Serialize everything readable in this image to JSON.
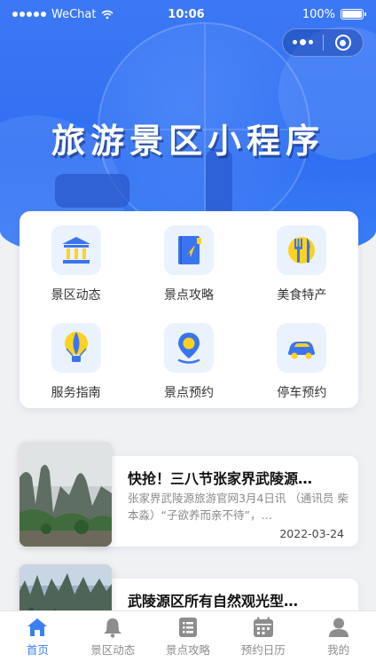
{
  "status_bar": {
    "carrier": "WeChat",
    "time": "10:06",
    "battery": "100%"
  },
  "hero": {
    "title": "旅游景区小程序"
  },
  "menu": {
    "items": [
      {
        "label": "景区动态",
        "icon": "museum-icon"
      },
      {
        "label": "景点攻略",
        "icon": "guidebook-icon"
      },
      {
        "label": "美食特产",
        "icon": "fork-knife-icon"
      },
      {
        "label": "服务指南",
        "icon": "hot-air-balloon-icon"
      },
      {
        "label": "景点预约",
        "icon": "location-pin-icon"
      },
      {
        "label": "停车预约",
        "icon": "car-icon"
      }
    ]
  },
  "news": [
    {
      "title": "快抢！三八节张家界武陵源…",
      "summary": "张家界武陵源旅游官网3月4日讯 （通讯员 柴本淼）“子欲养而亲不待”，…",
      "date": "2022-03-24"
    },
    {
      "title": "武陵源区所有自然观光型…",
      "summary": "",
      "date": ""
    }
  ],
  "tabbar": {
    "tabs": [
      {
        "label": "首页",
        "icon": "home-icon",
        "active": true
      },
      {
        "label": "景区动态",
        "icon": "bell-icon",
        "active": false
      },
      {
        "label": "景点攻略",
        "icon": "list-icon",
        "active": false
      },
      {
        "label": "预约日历",
        "icon": "calendar-icon",
        "active": false
      },
      {
        "label": "我的",
        "icon": "user-icon",
        "active": false
      }
    ]
  },
  "colors": {
    "primary": "#3c7ff5",
    "icon_blue": "#3a75ef",
    "icon_yellow": "#ffd21f",
    "hero_blue": "#2f6ff2"
  }
}
